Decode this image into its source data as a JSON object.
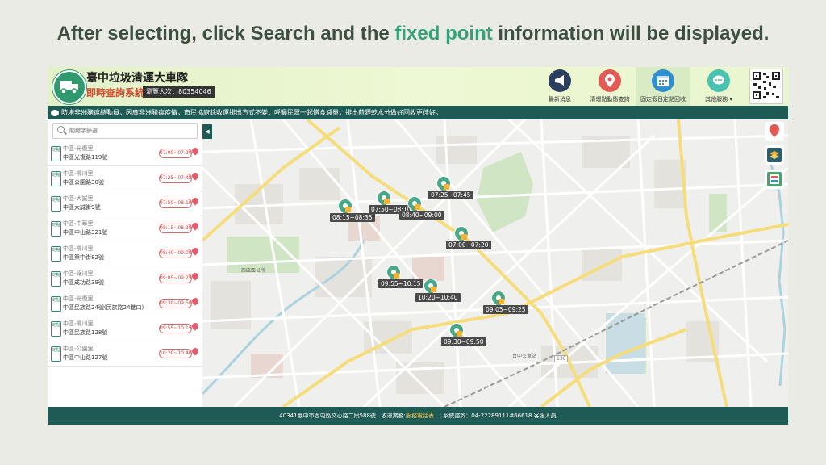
{
  "headline": {
    "part1": "After selecting, click  Search and the ",
    "highlight": "fixed point",
    "part2": " information will be displayed."
  },
  "header": {
    "title": "臺中垃圾清運大車隊",
    "subtitle": "即時查詢系統",
    "visits": "瀏覽人次：80354046"
  },
  "nav": [
    {
      "label": "最新消息",
      "icon": "megaphone-icon",
      "color": "#2d3f5e"
    },
    {
      "label": "清運點動態查詢",
      "icon": "location-pin-icon",
      "color": "#e35a55"
    },
    {
      "label": "固定假日定點回收",
      "icon": "calendar-icon",
      "color": "#2f8fd0"
    },
    {
      "label": "其他服務 ▾",
      "icon": "chat-bubble-icon",
      "color": "#49c2b1"
    }
  ],
  "ticker": "防堵非洲豬瘟總動員，因應非洲豬瘟疫情，市民協廚餘收運排出方式不變，呼籲民眾一起惜食減量，排出前瀝乾水分做好回收更佳好。",
  "search": {
    "placeholder": "關鍵字篩選"
  },
  "badge": "定點",
  "list": [
    {
      "area": "中區-光復里",
      "addr": "中區光復路119號",
      "time": "07:00~07:20"
    },
    {
      "area": "中區-柳川里",
      "addr": "中區公園路30號",
      "time": "07:25~07:45"
    },
    {
      "area": "中區-大誠里",
      "addr": "中區大誠街9號",
      "time": "07:50~08:10"
    },
    {
      "area": "中區-中華里",
      "addr": "中區中山路321號",
      "time": "08:15~08:35"
    },
    {
      "area": "中區-柳川里",
      "addr": "中區興中街82號",
      "time": "08:40~09:00"
    },
    {
      "area": "中區-綠川里",
      "addr": "中區成功路39號",
      "time": "09:05~09:25"
    },
    {
      "area": "中區-光復里",
      "addr": "中區民族路24號(民族路24巷口)",
      "time": "09:30~09:50"
    },
    {
      "area": "中區-柳川里",
      "addr": "中區民族路128號",
      "time": "09:55~10:15"
    },
    {
      "area": "中區-公園里",
      "addr": "中區中山路127號",
      "time": "10:20~10:40"
    }
  ],
  "markers": [
    "07:25~07:45",
    "08:15~08:35",
    "07:50~08:10",
    "08:40~09:00",
    "07:00~07:20",
    "09:55~10:15",
    "10:20~10:40",
    "09:05~09:25",
    "09:30~09:50"
  ],
  "map_labels": {
    "park": "西區區公所",
    "station": "台中火車站",
    "road1": "136"
  },
  "footer": {
    "address": "40341臺中市西屯區文心路二段588號",
    "service_label": "收運業務:",
    "service_link": "服務電話表",
    "hotline": "| 系統諮詢：04-22289111#66618 客服人員"
  }
}
